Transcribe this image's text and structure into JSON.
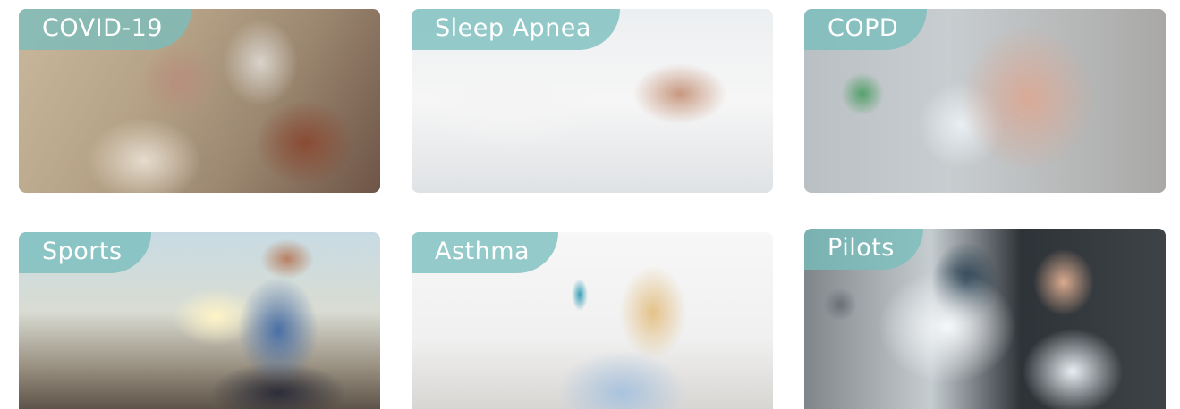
{
  "cards": [
    {
      "label": "COVID-19"
    },
    {
      "label": "Sleep Apnea"
    },
    {
      "label": "COPD"
    },
    {
      "label": "Sports"
    },
    {
      "label": "Asthma"
    },
    {
      "label": "Pilots"
    }
  ],
  "colors": {
    "tag_background": "#78bebc",
    "tag_text": "#ffffff"
  }
}
